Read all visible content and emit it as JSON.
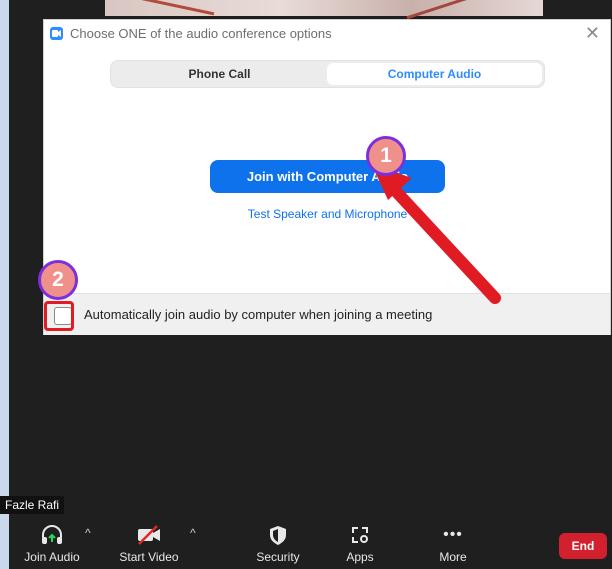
{
  "dialog": {
    "title": "Choose ONE of the audio conference options",
    "tabs": [
      {
        "label": "Phone Call",
        "selected": false
      },
      {
        "label": "Computer Audio",
        "selected": true
      }
    ],
    "join_button": "Join with Computer Audio",
    "test_link": "Test Speaker and Microphone",
    "auto_join_label": "Automatically join audio by computer when joining a meeting",
    "auto_join_checked": false
  },
  "annotations": {
    "marker_1": "1",
    "marker_2": "2",
    "arrow_color": "#e01b24",
    "marker_border_color": "#7b2fe0"
  },
  "participant": {
    "name": "Fazle Rafi"
  },
  "toolbar": {
    "join_audio": "Join Audio",
    "start_video": "Start Video",
    "security": "Security",
    "apps": "Apps",
    "more": "More",
    "end": "End"
  },
  "colors": {
    "accent": "#0e72ed",
    "end": "#d3202f",
    "toolbar_bg": "#1f1f1f"
  }
}
